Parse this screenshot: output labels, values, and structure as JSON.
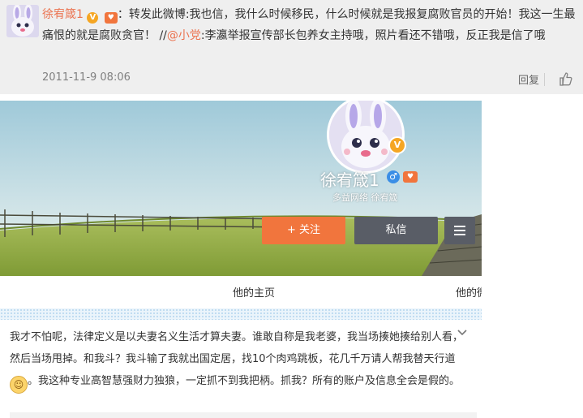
{
  "comment": {
    "username": "徐宥箴1",
    "colon_text": "：转发此微博:我也信，我什么时候移民，什么时候就是我报复腐败官员的开始！我这一生最痛恨的就是腐败贪官！ //",
    "mention": "@小党",
    "rest_text": ":李瀛举报宣传部长包养女主持哦，照片看还不错哦，反正我是信了哦",
    "timestamp": "2011-11-9 08:06",
    "reply_label": "回复"
  },
  "profile": {
    "name": "徐宥箴1",
    "description": "多益网络 徐宥箴",
    "follow_label": "+ 关注",
    "message_label": "私信"
  },
  "tabs": {
    "home": "他的主页",
    "second": "他的微"
  },
  "post": {
    "text_before_emoji": "我才不怕呢，法律定义是以夫妻名义生活才算夫妻。谁敢自称是我老婆，我当场揍她揍给别人看，然后当场甩掉。和我斗？我斗输了我就出国定居，找10个肉鸡跳板，花几千万请人帮我替天行道",
    "text_after_emoji": "。我这种专业高智慧强财力独狼，一定抓不到我把柄。抓我？所有的账户及信息全会是假的。"
  },
  "colors": {
    "accent_orange": "#f1753d",
    "username_orange": "#eb7350",
    "button_gray": "#595d66"
  }
}
